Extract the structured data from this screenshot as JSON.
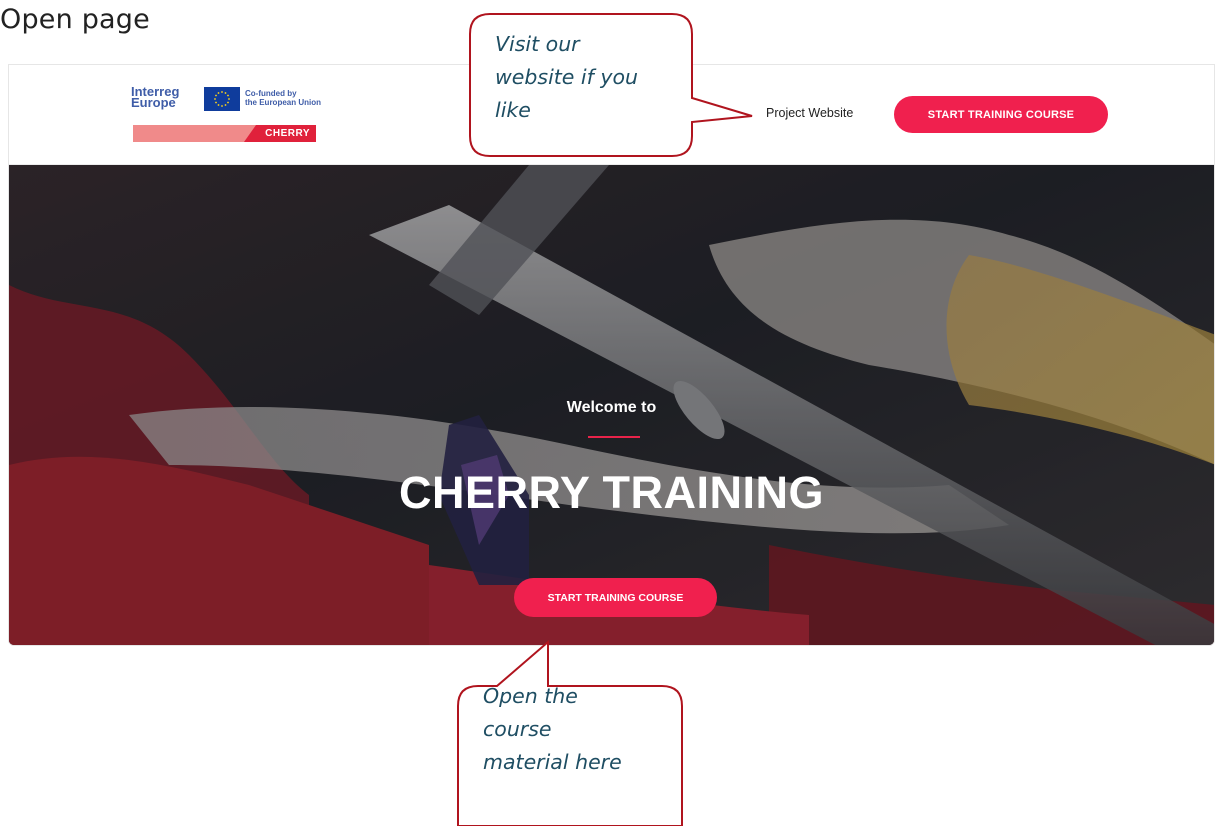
{
  "slide": {
    "title": "Open page"
  },
  "header": {
    "logo": {
      "interreg_line1": "Interreg",
      "interreg_line2": "Europe",
      "cofunded_line1": "Co-funded by",
      "cofunded_line2": "the European Union",
      "project_tag": "CHERRY"
    },
    "nav_link": "Project Website",
    "cta_label": "START TRAINING COURSE"
  },
  "hero": {
    "welcome": "Welcome to",
    "title": "CHERRY TRAINING",
    "cta_label": "START TRAINING COURSE"
  },
  "callouts": {
    "top": [
      "Visit our",
      "website if you",
      "like"
    ],
    "bottom": [
      "Open the",
      "course",
      "material here"
    ]
  },
  "colors": {
    "accent": "#f0204e",
    "callout_border": "#b0141e",
    "callout_text": "#1f4e63",
    "interreg_blue": "#3f5da8"
  }
}
